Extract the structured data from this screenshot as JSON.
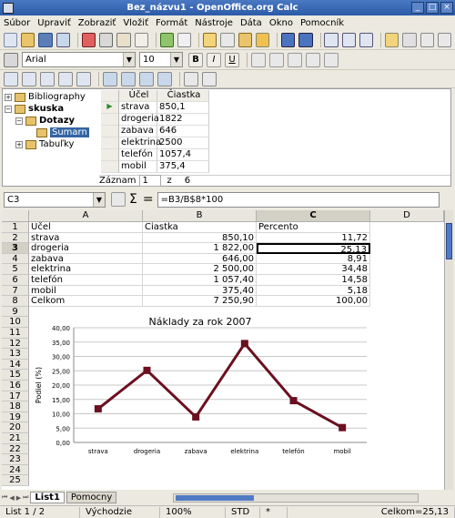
{
  "window": {
    "title": "Bez_názvu1 - OpenOffice.org Calc"
  },
  "menu": [
    "Súbor",
    "Upraviť",
    "Zobraziť",
    "Vložiť",
    "Formát",
    "Nástroje",
    "Dáta",
    "Okno",
    "Pomocník"
  ],
  "format_bar": {
    "style_value": "",
    "font_value": "Arial",
    "size_value": "10"
  },
  "datasource": {
    "tree": [
      {
        "label": "Bibliography",
        "level": 0,
        "expander": "+"
      },
      {
        "label": "skuska",
        "level": 0,
        "expander": "−",
        "bold": true
      },
      {
        "label": "Dotazy",
        "level": 1,
        "expander": "−",
        "bold": true
      },
      {
        "label": "Sumarn",
        "level": 2,
        "selected": true
      },
      {
        "label": "Tabuľky",
        "level": 1,
        "expander": "+"
      }
    ],
    "columns": [
      "Účel",
      "Čiastka"
    ],
    "rows": [
      [
        "strava",
        "850,1"
      ],
      [
        "drogeria",
        "1822"
      ],
      [
        "zabava",
        "646"
      ],
      [
        "elektrina",
        "2500"
      ],
      [
        "telefón",
        "1057,4"
      ],
      [
        "mobil",
        "375,4"
      ]
    ],
    "record_label": "Záznam",
    "record_current": "1",
    "record_of": "z",
    "record_total": "6"
  },
  "formula": {
    "cell_ref": "C3",
    "content": "=B3/B$8*100"
  },
  "sheet": {
    "columns": [
      "A",
      "B",
      "C",
      "D"
    ],
    "rows": [
      [
        "Účel",
        "Čiastka",
        "Percento"
      ],
      [
        "strava",
        "850,10",
        "11,72"
      ],
      [
        "drogeria",
        "1 822,00",
        "25,13"
      ],
      [
        "zabava",
        "646,00",
        "8,91"
      ],
      [
        "elektrina",
        "2 500,00",
        "34,48"
      ],
      [
        "telefón",
        "1 057,40",
        "14,58"
      ],
      [
        "mobil",
        "375,40",
        "5,18"
      ],
      [
        "Celkom",
        "7 250,90",
        "100,00"
      ]
    ],
    "row_numbers": [
      "1",
      "2",
      "3",
      "4",
      "5",
      "6",
      "7",
      "8",
      "9",
      "10",
      "11",
      "12",
      "13",
      "14",
      "15",
      "16",
      "17",
      "18",
      "19",
      "20",
      "21",
      "22",
      "23",
      "24",
      "25"
    ],
    "tabs": [
      "List1",
      "Pomocny"
    ]
  },
  "chart_data": {
    "type": "line",
    "title": "Náklady za rok 2007",
    "ylabel": "Podiel (%)",
    "xlabel": "",
    "categories": [
      "strava",
      "drogeria",
      "zabava",
      "elektrina",
      "telefón",
      "mobil"
    ],
    "values": [
      11.72,
      25.13,
      8.91,
      34.48,
      14.58,
      5.18
    ],
    "ylim": [
      0,
      40
    ],
    "yticks": [
      "0,00",
      "5,00",
      "10,00",
      "15,00",
      "20,00",
      "25,00",
      "30,00",
      "35,00",
      "40,00"
    ],
    "grid": true,
    "line_color": "#6b1020"
  },
  "status": {
    "sheet": "List 1 / 2",
    "style": "Východzie",
    "zoom": "100%",
    "mode": "STD",
    "modified": "*",
    "sum": "Celkom=25,13"
  }
}
